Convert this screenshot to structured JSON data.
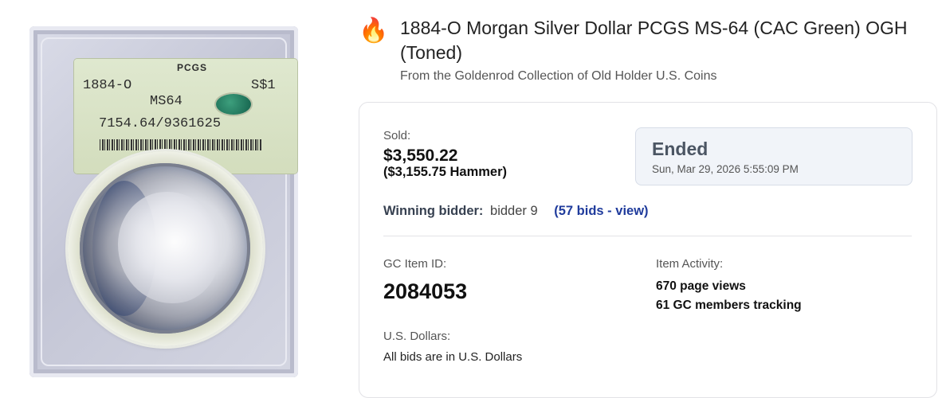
{
  "image": {
    "slab_grader": "PCGS",
    "slab_date": "1884-O",
    "slab_denomination": "S$1",
    "slab_grade": "MS64",
    "slab_cert": "7154.64/9361625",
    "cac_sticker_color": "#1f7a5c"
  },
  "header": {
    "icon": "fire-icon",
    "title": "1884-O Morgan Silver Dollar PCGS MS-64 (CAC Green) OGH (Toned)",
    "subtitle": "From the Goldenrod Collection of Old Holder U.S. Coins"
  },
  "sale": {
    "sold_label": "Sold:",
    "price": "$3,550.22",
    "hammer_amount": "($3,155.75",
    "hammer_word": "Hammer)"
  },
  "status": {
    "label": "Ended",
    "end_time": "Sun, Mar 29, 2026 5:55:09 PM"
  },
  "winner": {
    "label": "Winning bidder:",
    "name": "bidder 9",
    "bids_link": "(57 bids - view)"
  },
  "item": {
    "id_label": "GC Item ID:",
    "id_value": "2084053"
  },
  "activity": {
    "label": "Item Activity:",
    "views": "670 page views",
    "tracking": "61 GC members tracking"
  },
  "currency": {
    "label": "U.S. Dollars:",
    "note": "All bids are in U.S. Dollars"
  },
  "colors": {
    "link": "#1f3b9c",
    "status_bg": "#f1f4f9"
  }
}
